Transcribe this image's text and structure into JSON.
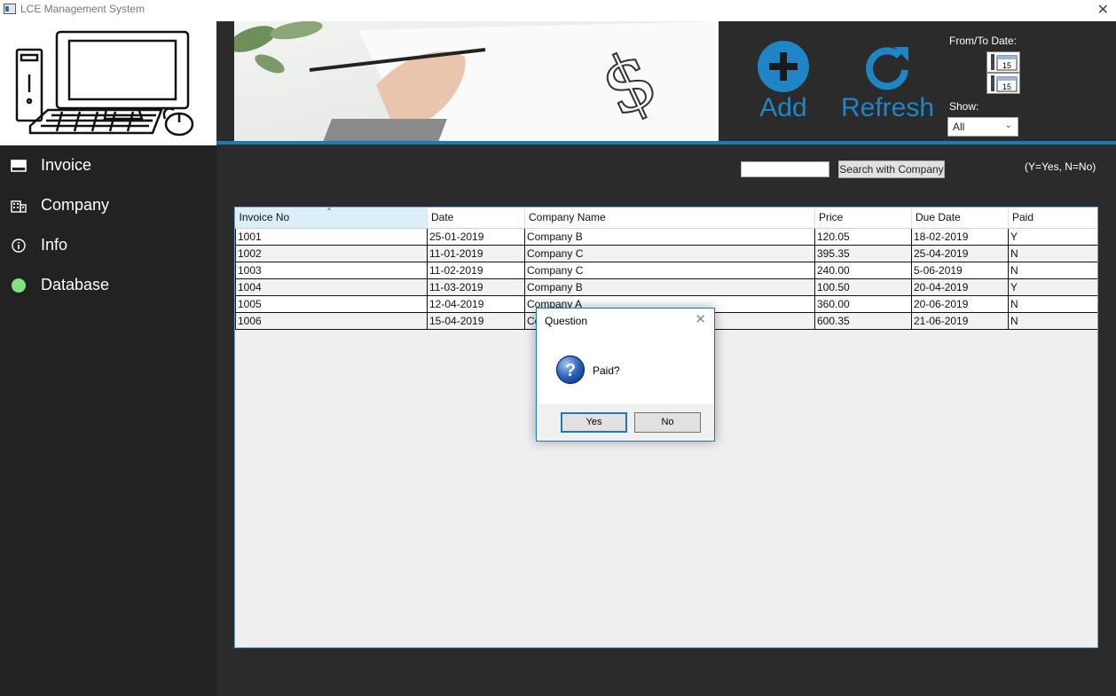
{
  "window": {
    "title": "LCE Management System",
    "close_glyph": "✕"
  },
  "sidebar": {
    "items": [
      {
        "label": "Invoice",
        "icon": "inbox-icon"
      },
      {
        "label": "Company",
        "icon": "building-icon"
      },
      {
        "label": "Info",
        "icon": "info-icon"
      },
      {
        "label": "Database",
        "icon": "status-dot-icon"
      }
    ]
  },
  "toolbar": {
    "add_label": "Add",
    "refresh_label": "Refresh",
    "from_to_label": "From/To Date:",
    "calendar_day": "15",
    "show_label": "Show:",
    "show_value": "All"
  },
  "search": {
    "value": "",
    "button_label": "Search with Company",
    "legend": "(Y=Yes, N=No)"
  },
  "grid": {
    "columns": [
      "Invoice No",
      "Date",
      "Company Name",
      "Price",
      "Due Date",
      "Paid"
    ],
    "rows": [
      [
        "1001",
        "25-01-2019",
        "Company B",
        "120.05",
        "18-02-2019",
        "Y"
      ],
      [
        "1002",
        "11-01-2019",
        "Company C",
        "395.35",
        "25-04-2019",
        "N"
      ],
      [
        "1003",
        "11-02-2019",
        "Company C",
        "240.00",
        "5-06-2019",
        "N"
      ],
      [
        "1004",
        "11-03-2019",
        "Company B",
        "100.50",
        "20-04-2019",
        "Y"
      ],
      [
        "1005",
        "12-04-2019",
        "Company A",
        "360.00",
        "20-06-2019",
        "N"
      ],
      [
        "1006",
        "15-04-2019",
        "Company C",
        "600.35",
        "21-06-2019",
        "N"
      ]
    ]
  },
  "dialog": {
    "title": "Question",
    "close_glyph": "✕",
    "message": "Paid?",
    "yes_label": "Yes",
    "no_label": "No"
  },
  "colors": {
    "accent": "#1f85c7",
    "sidebar_bg": "#222222",
    "header_bg": "#2b2b2b",
    "status_green": "#7ee37c"
  }
}
